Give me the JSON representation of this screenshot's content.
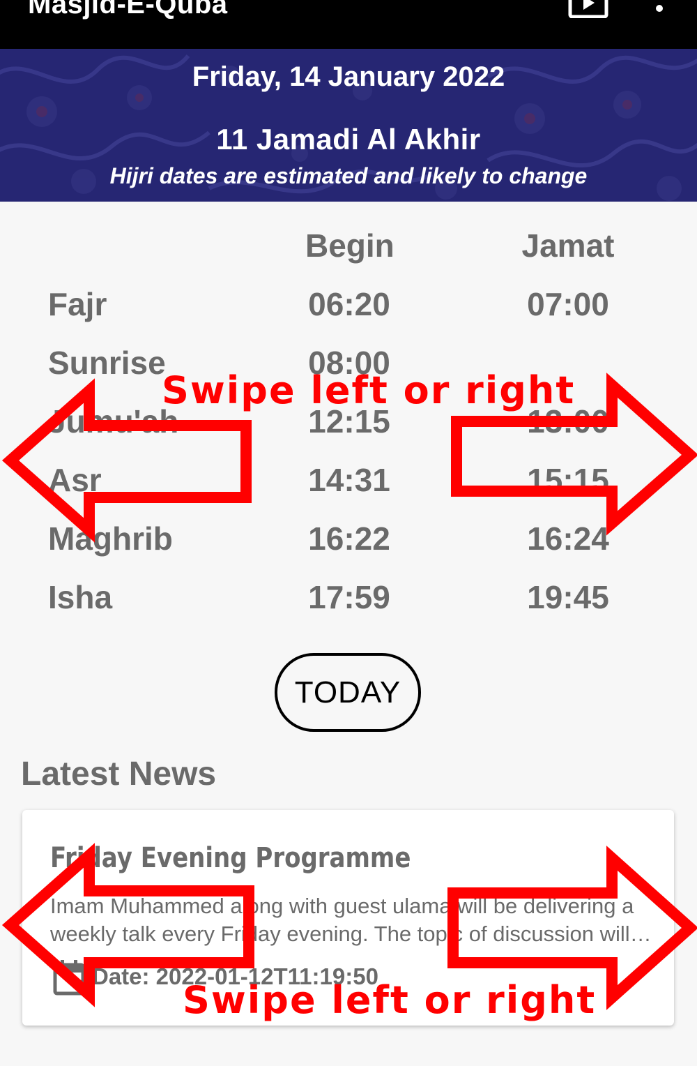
{
  "app": {
    "title": "Masjid-E-Quba",
    "icons": [
      "play-video-icon",
      "more-vert-icon"
    ]
  },
  "banner": {
    "gregorian_date": "Friday, 14 January 2022",
    "hijri_date": "11 Jamadi Al Akhir",
    "hijri_note": "Hijri dates are estimated and likely to change"
  },
  "timetable": {
    "headers": {
      "begin": "Begin",
      "jamat": "Jamat"
    },
    "rows": [
      {
        "name": "Fajr",
        "begin": "06:20",
        "jamat": "07:00"
      },
      {
        "name": "Sunrise",
        "begin": "08:00",
        "jamat": ""
      },
      {
        "name": "Jumu'ah",
        "begin": "12:15",
        "jamat": "13:00"
      },
      {
        "name": "Asr",
        "begin": "14:31",
        "jamat": "15:15"
      },
      {
        "name": "Maghrib",
        "begin": "16:22",
        "jamat": "16:24"
      },
      {
        "name": "Isha",
        "begin": "17:59",
        "jamat": "19:45"
      }
    ]
  },
  "today_button": "TODAY",
  "news": {
    "heading": "Latest News",
    "items": [
      {
        "title": "Friday Evening Programme",
        "body": "Imam Muhammed along with guest ulama will be delivering a weekly talk every Friday evening. The topic of discussion will be announced each week.",
        "date": "Date: 2022-01-12T11:19:50",
        "icon": "calendar-icon"
      }
    ]
  },
  "annotations": {
    "swipe_top": "Swipe left or right",
    "swipe_bottom": "Swipe left or right",
    "arrow_color": "#ff0000"
  },
  "colors": {
    "app_bar": "#000000",
    "banner": "#262673",
    "text_grey": "#6a6a6a",
    "background": "#f7f7f7"
  }
}
